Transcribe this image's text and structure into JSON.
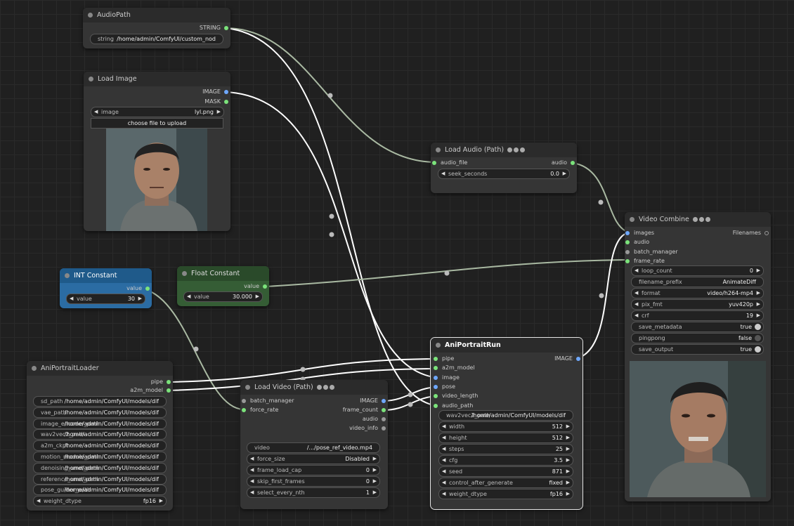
{
  "nodes": {
    "audio_path": {
      "title": "AudioPath",
      "output": "STRING",
      "widget": {
        "label": "string",
        "value": "/home/admin/ComfyUI/custom_nod"
      }
    },
    "load_image": {
      "title": "Load Image",
      "outputs": [
        "IMAGE",
        "MASK"
      ],
      "image_select": {
        "label": "image",
        "value": "lyl.png"
      },
      "upload": "choose file to upload"
    },
    "int_constant": {
      "title": "INT Constant",
      "output": "value",
      "widget": {
        "label": "value",
        "value": "30"
      }
    },
    "float_constant": {
      "title": "Float Constant",
      "output": "value",
      "widget": {
        "label": "value",
        "value": "30.000"
      }
    },
    "load_audio": {
      "title": "Load Audio (Path)",
      "input": "audio_file",
      "output": "audio",
      "widget": {
        "label": "seek_seconds",
        "value": "0.0"
      }
    },
    "video_combine": {
      "title": "Video Combine",
      "inputs": [
        "images",
        "audio",
        "batch_manager",
        "frame_rate"
      ],
      "output": "Filenames",
      "widgets": [
        {
          "label": "loop_count",
          "value": "0"
        },
        {
          "label": "filename_prefix",
          "value": "AnimateDiff"
        },
        {
          "label": "format",
          "value": "video/h264-mp4"
        },
        {
          "label": "pix_fmt",
          "value": "yuv420p"
        },
        {
          "label": "crf",
          "value": "19"
        },
        {
          "label": "save_metadata",
          "value": "true"
        },
        {
          "label": "pingpong",
          "value": "false"
        },
        {
          "label": "save_output",
          "value": "true"
        }
      ]
    },
    "loader": {
      "title": "AniPortraitLoader",
      "outputs": [
        "pipe",
        "a2m_model"
      ],
      "widgets": [
        {
          "label": "sd_path",
          "value": "/home/admin/ComfyUI/models/dif"
        },
        {
          "label": "vae_path",
          "value": "/home/admin/ComfyUI/models/dif"
        },
        {
          "label": "image_encoder_path",
          "value": "/home/admin/ComfyUI/models/dif"
        },
        {
          "label": "wav2vec2_path",
          "value": "/home/admin/ComfyUI/models/dif"
        },
        {
          "label": "a2m_ckpt",
          "value": "/home/admin/ComfyUI/models/dif"
        },
        {
          "label": "motion_module_path",
          "value": "/home/admin/ComfyUI/models/dif"
        },
        {
          "label": "denoising_unet_path",
          "value": "/home/admin/ComfyUI/models/dif"
        },
        {
          "label": "reference_unet_path",
          "value": "/home/admin/ComfyUI/models/dif"
        },
        {
          "label": "pose_guider_path",
          "value": "/home/admin/ComfyUI/models/dif"
        },
        {
          "label": "weight_dtype",
          "value": "fp16"
        }
      ]
    },
    "load_video": {
      "title": "Load Video (Path)",
      "inputs": [
        "batch_manager",
        "force_rate"
      ],
      "outputs": [
        "IMAGE",
        "frame_count",
        "audio",
        "video_info"
      ],
      "widgets": [
        {
          "label": "video",
          "value": "/.../pose_ref_video.mp4"
        },
        {
          "label": "force_size",
          "value": "Disabled"
        },
        {
          "label": "frame_load_cap",
          "value": "0"
        },
        {
          "label": "skip_first_frames",
          "value": "0"
        },
        {
          "label": "select_every_nth",
          "value": "1"
        }
      ]
    },
    "run": {
      "title": "AniPortraitRun",
      "inputs": [
        "pipe",
        "a2m_model",
        "image",
        "pose",
        "video_length",
        "audio_path"
      ],
      "output": "IMAGE",
      "widgets": [
        {
          "label": "wav2vec2_path",
          "value": "/home/admin/ComfyUI/models/dif"
        },
        {
          "label": "width",
          "value": "512"
        },
        {
          "label": "height",
          "value": "512"
        },
        {
          "label": "steps",
          "value": "25"
        },
        {
          "label": "cfg",
          "value": "3.5"
        },
        {
          "label": "seed",
          "value": "871"
        },
        {
          "label": "control_after_generate",
          "value": "fixed"
        },
        {
          "label": "weight_dtype",
          "value": "fp16"
        }
      ]
    }
  },
  "colors": {
    "image_slot": "#6fa8ff",
    "generic_slot": "#7be37b",
    "int_node": "#2b6ca3",
    "float_node": "#355d35"
  },
  "icons": [
    "node-collapse-dot-icon",
    "arrow-left-icon",
    "arrow-right-icon",
    "toggle-icon",
    "badge-icon"
  ]
}
